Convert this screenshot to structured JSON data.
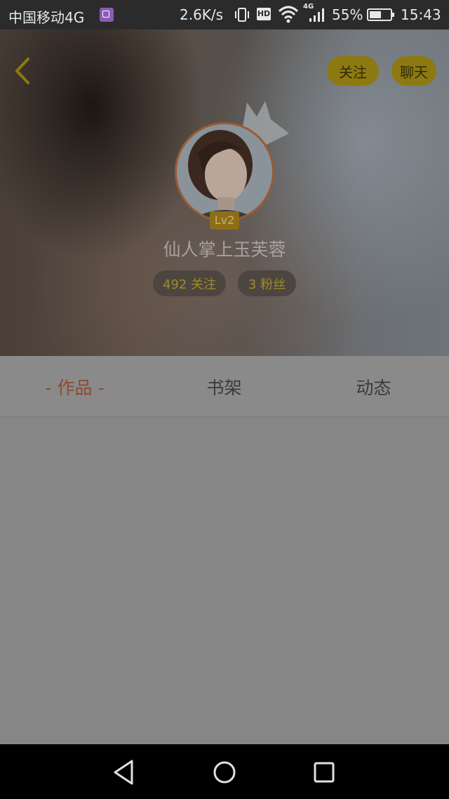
{
  "status_bar": {
    "carrier": "中国移动4G",
    "speed": "2.6K/s",
    "hd_label": "HD",
    "network_label": "4G",
    "battery": "55%",
    "time": "15:43",
    "battery_level": 0.55
  },
  "header": {
    "follow_label": "关注",
    "chat_label": "聊天",
    "level": "Lv2",
    "username": "仙人掌上玉芙蓉",
    "following_stat": "492 关注",
    "fans_stat": "3 粉丝"
  },
  "tabs": [
    {
      "label": "- 作品 -",
      "active": true
    },
    {
      "label": "书架",
      "active": false
    },
    {
      "label": "动态",
      "active": false
    }
  ],
  "colors": {
    "accent": "#c8a818",
    "active_tab": "#8e4a2e",
    "avatar_ring": "#9a5a32"
  }
}
